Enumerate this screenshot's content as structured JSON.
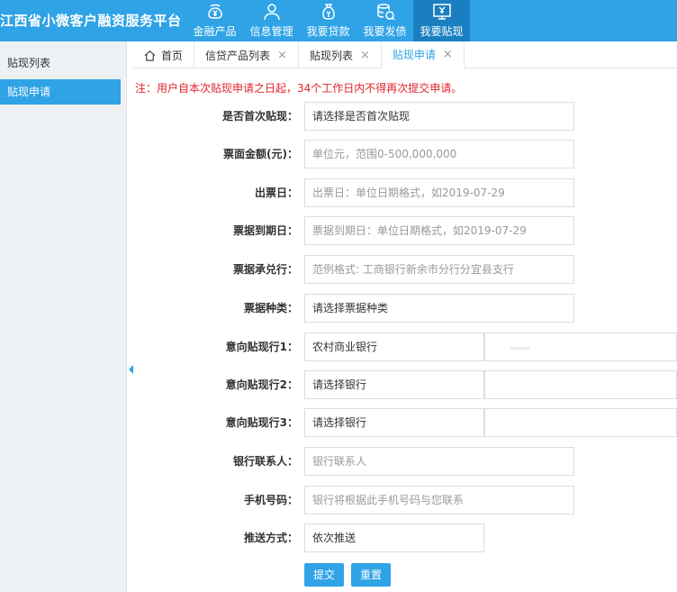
{
  "app": {
    "title": "江西省小微客户融资服务平台"
  },
  "nav": [
    {
      "label": "金融产品",
      "icon": "money-bag-icon"
    },
    {
      "label": "信息管理",
      "icon": "user-icon"
    },
    {
      "label": "我要贷款",
      "icon": "loan-bag-icon"
    },
    {
      "label": "我要发债",
      "icon": "coin-stack-icon"
    },
    {
      "label": "我要贴现",
      "icon": "discount-monitor-icon"
    }
  ],
  "sidebar": {
    "items": [
      {
        "label": "贴现列表"
      },
      {
        "label": "贴现申请"
      }
    ]
  },
  "tabs": [
    {
      "label": "首页"
    },
    {
      "label": "信贷产品列表"
    },
    {
      "label": "贴现列表"
    },
    {
      "label": "贴现申请"
    }
  ],
  "notice": "注：用户自本次贴现申请之日起，34个工作日内不得再次提交申请。",
  "form": {
    "first_discount": {
      "label": "是否首次贴现：",
      "value": "请选择是否首次贴现"
    },
    "face_amount": {
      "label": "票面金额(元)：",
      "placeholder": "单位元，范围0-500,000,000"
    },
    "issue_date": {
      "label": "出票日：",
      "placeholder": "出票日：单位日期格式，如2019-07-29"
    },
    "due_date": {
      "label": "票据到期日：",
      "placeholder": "票据到期日：单位日期格式，如2019-07-29"
    },
    "acceptor_bank": {
      "label": "票据承兑行：",
      "placeholder": "范例格式: 工商银行新余市分行分宜县支行"
    },
    "bill_type": {
      "label": "票据种类：",
      "value": "请选择票据种类"
    },
    "bank1": {
      "label": "意向贴现行1：",
      "value": "农村商业银行"
    },
    "bank2": {
      "label": "意向贴现行2：",
      "value": "请选择银行"
    },
    "bank3": {
      "label": "意向贴现行3：",
      "value": "请选择银行"
    },
    "contact": {
      "label": "银行联系人：",
      "placeholder": "银行联系人"
    },
    "phone": {
      "label": "手机号码：",
      "placeholder": "银行将根据此手机号码与您联系"
    },
    "push": {
      "label": "推送方式：",
      "value": "依次推送"
    }
  },
  "buttons": {
    "submit": "提交",
    "reset": "重置"
  },
  "colors": {
    "primary": "#2fa3e6",
    "primary_dark": "#1a7fc0",
    "notice": "#e0242b"
  }
}
